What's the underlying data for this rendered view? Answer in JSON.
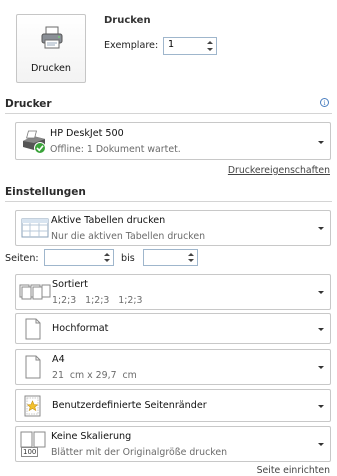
{
  "print": {
    "button_label": "Drucken",
    "section_title": "Drucken",
    "copies_label": "Exemplare:",
    "copies_value": "1"
  },
  "printer": {
    "header": "Drucker",
    "info_icon": "info-icon",
    "name": "HP DeskJet 500",
    "status": "Offline: 1 Dokument wartet.",
    "properties_link": "Druckereigenschaften"
  },
  "settings": {
    "header": "Einstellungen",
    "scope": {
      "title": "Aktive Tabellen drucken",
      "subtitle": "Nur die aktiven Tabellen drucken"
    },
    "pages": {
      "label": "Seiten:",
      "from_value": "",
      "to_label": "bis",
      "to_value": ""
    },
    "collation": {
      "title": "Sortiert",
      "subtitle": "1;2;3   1;2;3   1;2;3"
    },
    "orientation": {
      "title": "Hochformat"
    },
    "paper": {
      "title": "A4",
      "subtitle": "21  cm x 29,7  cm"
    },
    "margins": {
      "title": "Benutzerdefinierte Seitenränder"
    },
    "scaling": {
      "title": "Keine Skalierung",
      "subtitle": "Blätter mit der Originalgröße drucken",
      "icon_text": "100"
    }
  },
  "footer": {
    "page_setup_link": "Seite einrichten"
  }
}
